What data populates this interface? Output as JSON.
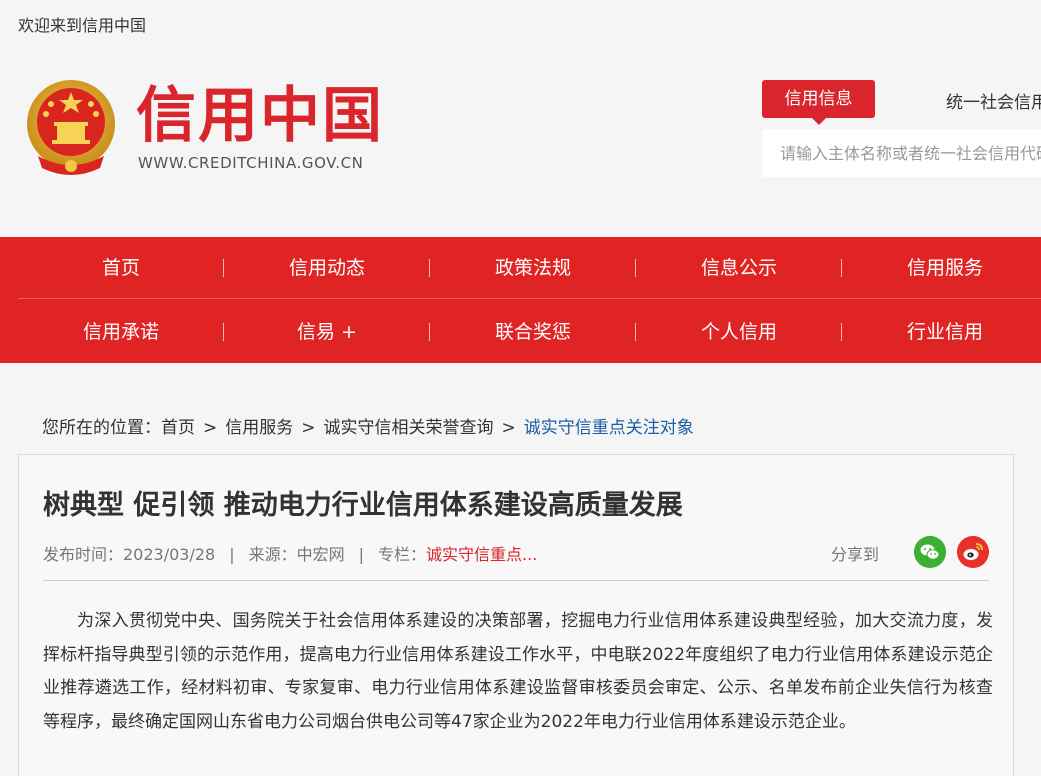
{
  "header": {
    "welcome": "欢迎来到信用中国",
    "logo_title": "信用中国",
    "logo_url": "WWW.CREDITCHINA.GOV.CN",
    "emblem_icon": "national-emblem-icon"
  },
  "search": {
    "tab_active": "信用信息",
    "tab_other": "统一社会信用代码",
    "placeholder": "请输入主体名称或者统一社会信用代码"
  },
  "nav": {
    "row1": [
      "首页",
      "信用动态",
      "政策法规",
      "信息公示",
      "信用服务"
    ],
    "row2": [
      "信用承诺",
      "信易 +",
      "联合奖惩",
      "个人信用",
      "行业信用"
    ]
  },
  "breadcrumb": {
    "prefix": "您所在的位置：",
    "items": [
      "首页",
      "信用服务",
      "诚实守信相关荣誉查询"
    ],
    "current": "诚实守信重点关注对象",
    "separator": ">"
  },
  "article": {
    "title": "树典型 促引领 推动电力行业信用体系建设高质量发展",
    "publish_time": "发布时间：2023/03/28",
    "source": "来源：中宏网",
    "column_label": "专栏：",
    "column_value": "诚实守信重点...",
    "meta_sep": "|",
    "share_label": "分享到",
    "share_icons": [
      "wechat-icon",
      "weibo-icon"
    ],
    "body": "为深入贯彻党中央、国务院关于社会信用体系建设的决策部署，挖掘电力行业信用体系建设典型经验，加大交流力度，发挥标杆指导典型引领的示范作用，提高电力行业信用体系建设工作水平，中电联2022年度组织了电力行业信用体系建设示范企业推荐遴选工作，经材料初审、专家复审、电力行业信用体系建设监督审核委员会审定、公示、名单发布前企业失信行为核查等程序，最终确定国网山东省电力公司烟台供电公司等47家企业为2022年电力行业信用体系建设示范企业。"
  },
  "colors": {
    "brand_red": "#d9252b",
    "nav_red": "#e02424",
    "link_blue": "#1a5fa8"
  }
}
